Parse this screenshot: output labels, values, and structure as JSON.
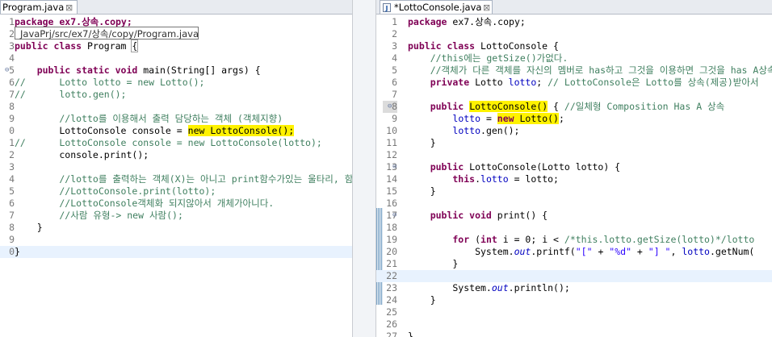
{
  "left_tab": {
    "title": "Program.java",
    "close": "⊠"
  },
  "right_tab": {
    "title": "*LottoConsole.java",
    "close": "⊠",
    "icon": "J"
  },
  "tooltip": "JavaPrj/src/ex7/상속/copy/Program.java",
  "left_lines": [
    "1",
    "2",
    "3",
    "4",
    "5",
    "6",
    "7",
    "8",
    "9",
    "0",
    "1",
    "2",
    "3",
    "4",
    "5",
    "6",
    "7",
    "8",
    "9",
    "0"
  ],
  "left_code": {
    "l1": "package ex7.상속.copy;",
    "l3a": "public class",
    "l3b": " Program ",
    "l3c": "{",
    "l5a": "    public static void",
    "l5b": " main(String[] args) {",
    "l6a": "//",
    "l6b": "      Lotto lotto = new Lotto();",
    "l7a": "//",
    "l7b": "      lotto.gen();",
    "l9": "        //lotto를 이용해서 출력 담당하는 객체 (객체지향)",
    "l10a": "        LottoConsole console = ",
    "l10b": "new LottoConsole()",
    "l10c": ";",
    "l11a": "//",
    "l11b": "      LottoConsole console = new LottoConsole(lotto);",
    "l12": "        console.print();",
    "l14": "        //lotto를 출력하는 객체(X)는 아니고 print함수가있는 울타리, 함",
    "l15": "        //LottoConsole.print(lotto);",
    "l16": "        //LottoConsole객체화 되지않아서 개체가아니다.",
    "l17": "        //사람 유형-> new 사람();",
    "l18": "    }",
    "l20": "}"
  },
  "right_lines": [
    "1",
    "2",
    "3",
    "4",
    "5",
    "6",
    "7",
    "8",
    "9",
    "10",
    "11",
    "12",
    "13",
    "14",
    "15",
    "16",
    "17",
    "18",
    "19",
    "20",
    "21",
    "22",
    "23",
    "24",
    "25",
    "26",
    "27"
  ],
  "right_code": {
    "r1a": "package",
    "r1b": " ex7.상속.copy;",
    "r3a": "public class",
    "r3b": " LottoConsole {",
    "r4": "    //this에는 getSize()가없다.",
    "r5": "    //객체가 다른 객체를 자신의 멤버로 has하고 그것을 이용하면 그것을 has A상속",
    "r6a": "    private",
    "r6b": " Lotto ",
    "r6c": "lotto",
    "r6d": "; ",
    "r6e": "// LottoConsole은 Lotto를 상속(제공)받아서",
    "r8a": "    public",
    "r8b": " ",
    "r8c": "LottoConsole()",
    "r8d": " { ",
    "r8e": "//일체형 Composition Has A 상속",
    "r9a": "        ",
    "r9b": "lotto",
    "r9c": " = ",
    "r9d": "new",
    "r9e": " Lotto()",
    "r9f": ";",
    "r10a": "        ",
    "r10b": "lotto",
    "r10c": ".gen();",
    "r11": "    }",
    "r13a": "    public",
    "r13b": " LottoConsole(Lotto lotto) {",
    "r14a": "        this",
    "r14b": ".",
    "r14c": "lotto",
    "r14d": " = lotto;",
    "r15": "    }",
    "r17a": "    public void",
    "r17b": " print() {",
    "r19a": "        for",
    "r19b": " (",
    "r19c": "int",
    "r19d": " i = 0; i < ",
    "r19e": "/*this.lotto.getSize(lotto)*/lotto",
    "r20a": "            System.",
    "r20b": "out",
    "r20c": ".printf(",
    "r20d": "\"[\"",
    "r20e": " + ",
    "r20f": "\"%d\"",
    "r20g": " + ",
    "r20h": "\"] \"",
    "r20i": ", ",
    "r20j": "lotto",
    "r20k": ".getNum(",
    "r21": "        }",
    "r23a": "        System.",
    "r23b": "out",
    "r23c": ".println();",
    "r24": "    }",
    "r27": "}"
  }
}
